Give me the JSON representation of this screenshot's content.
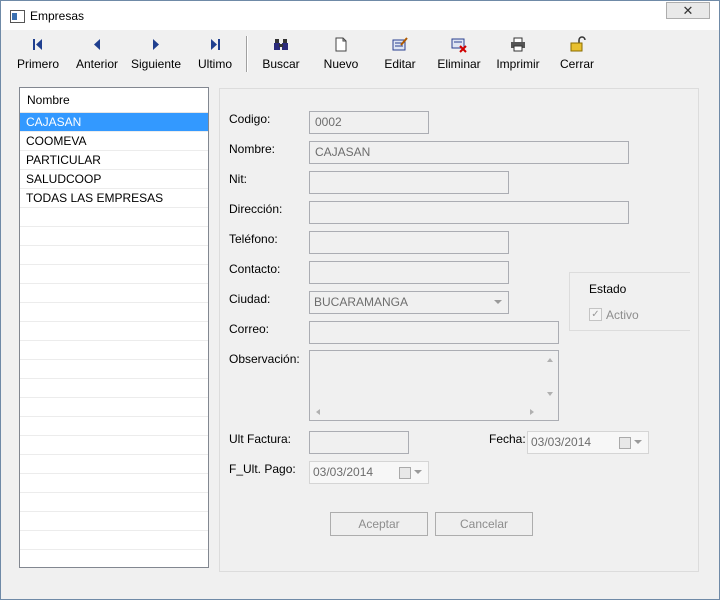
{
  "window": {
    "title": "Empresas",
    "close_label": "✕"
  },
  "toolbar": {
    "primero": "Primero",
    "anterior": "Anterior",
    "siguiente": "Siguiente",
    "ultimo": "Ultimo",
    "buscar": "Buscar",
    "nuevo": "Nuevo",
    "editar": "Editar",
    "eliminar": "Eliminar",
    "imprimir": "Imprimir",
    "cerrar": "Cerrar"
  },
  "list": {
    "header": "Nombre",
    "items": [
      "CAJASAN",
      "COOMEVA",
      "PARTICULAR",
      "SALUDCOOP",
      "TODAS LAS EMPRESAS"
    ],
    "selected_index": 0
  },
  "form": {
    "codigo": {
      "label": "Codigo:",
      "value": "0002"
    },
    "nombre": {
      "label": "Nombre:",
      "value": "CAJASAN"
    },
    "nit": {
      "label": "Nit:",
      "value": ""
    },
    "direccion": {
      "label": "Dirección:",
      "value": ""
    },
    "telefono": {
      "label": "Teléfono:",
      "value": ""
    },
    "contacto": {
      "label": "Contacto:",
      "value": ""
    },
    "ciudad": {
      "label": "Ciudad:",
      "value": "BUCARAMANGA"
    },
    "correo": {
      "label": "Correo:",
      "value": ""
    },
    "observacion": {
      "label": "Observación:",
      "value": ""
    },
    "ult_factura": {
      "label": "Ult Factura:",
      "value": ""
    },
    "fecha": {
      "label": "Fecha:",
      "value": "03/03/2014"
    },
    "f_ult_pago": {
      "label": "F_Ult. Pago:",
      "value": "03/03/2014"
    },
    "estado": {
      "title": "Estado",
      "activo_label": "Activo",
      "activo_checked": true
    }
  },
  "buttons": {
    "aceptar": "Aceptar",
    "cancelar": "Cancelar"
  },
  "colors": {
    "selection": "#3399ff",
    "toolbar_icon": "#1f3f8f"
  }
}
